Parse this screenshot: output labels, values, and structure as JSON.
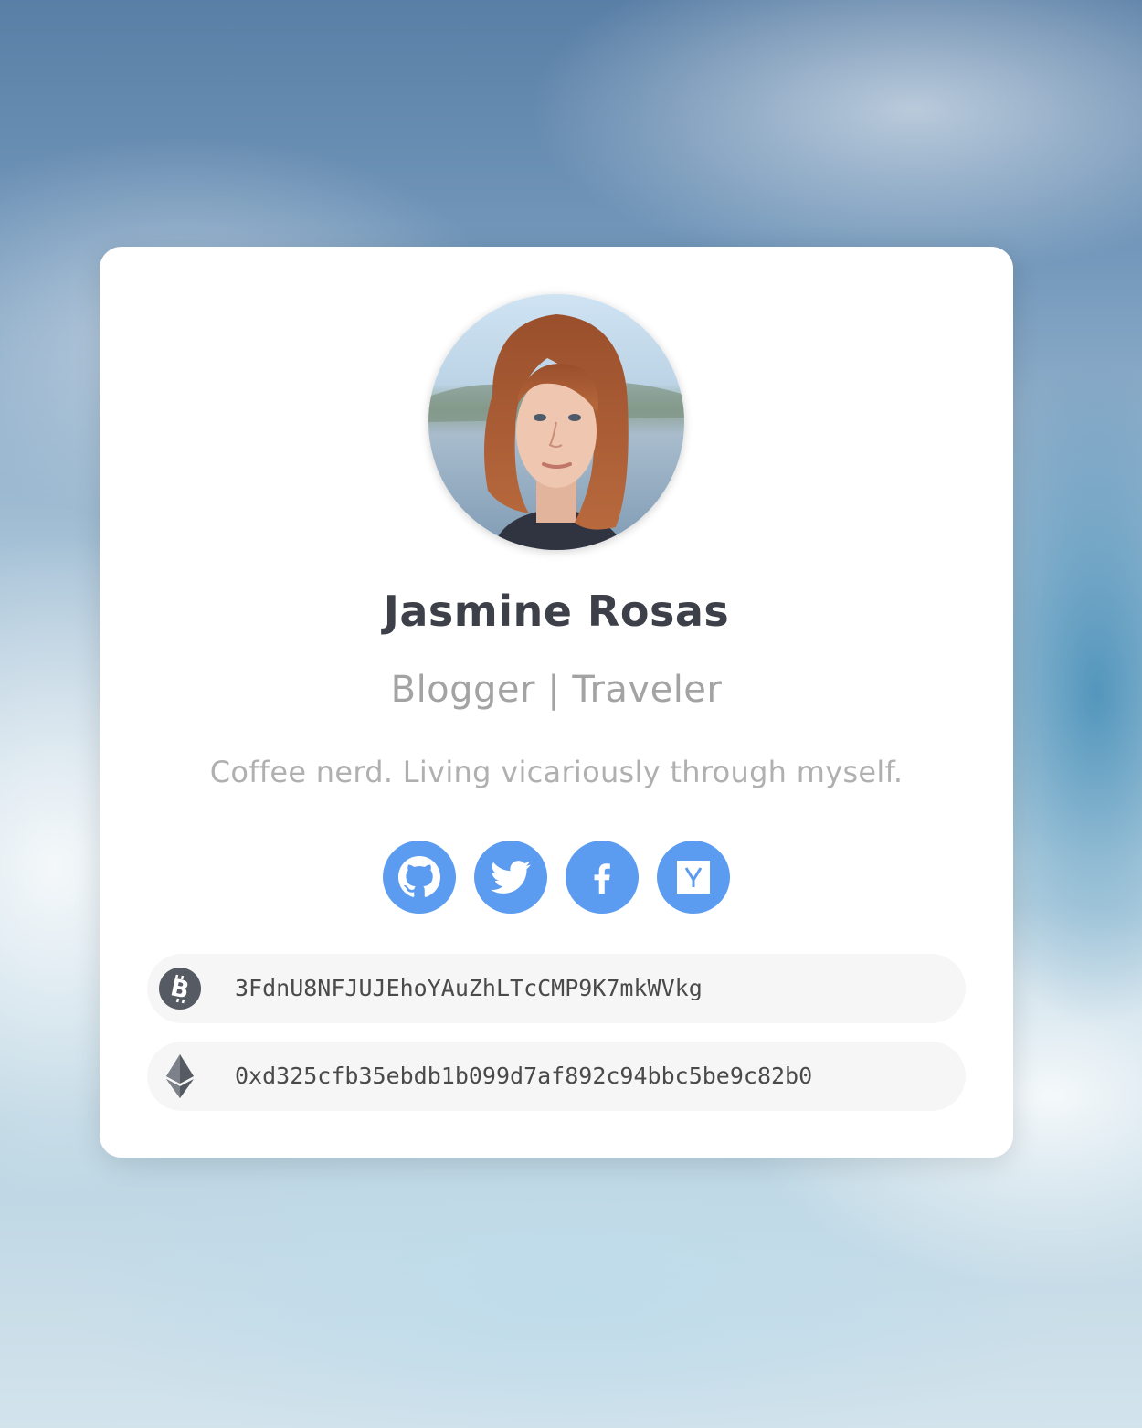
{
  "profile": {
    "name": "Jasmine Rosas",
    "role": "Blogger | Traveler",
    "bio": "Coffee nerd. Living vicariously through myself."
  },
  "socials": [
    {
      "name": "github",
      "icon": "github-icon"
    },
    {
      "name": "twitter",
      "icon": "twitter-icon"
    },
    {
      "name": "facebook",
      "icon": "facebook-icon"
    },
    {
      "name": "hacker-news",
      "icon": "hacker-news-icon"
    }
  ],
  "wallets": [
    {
      "coin": "bitcoin",
      "icon": "bitcoin-icon",
      "address": "3FdnU8NFJUJEhoYAuZhLTcCMP9K7mkWVkg"
    },
    {
      "coin": "ethereum",
      "icon": "ethereum-icon",
      "address": "0xd325cfb35ebdb1b099d7af892c94bbc5be9c82b0"
    }
  ],
  "colors": {
    "accent": "#5c9cf0",
    "name_text": "#3d4049",
    "muted_text": "#a3a3a3",
    "wallet_bg": "#f6f6f6",
    "coin_icon": "#555a63"
  }
}
